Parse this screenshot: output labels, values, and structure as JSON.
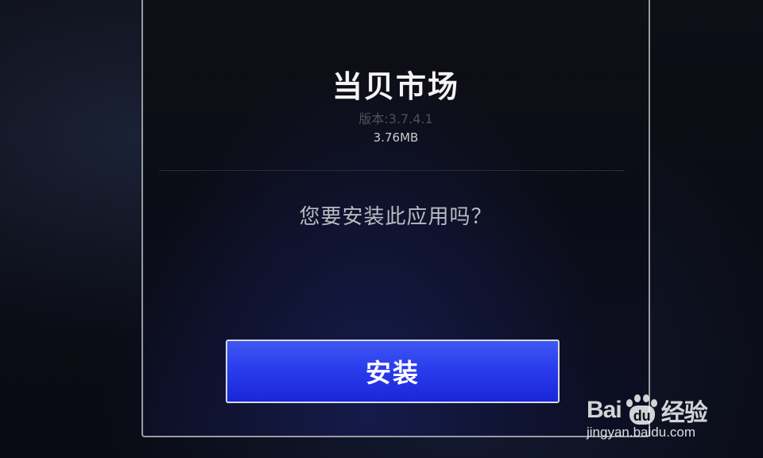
{
  "dialog": {
    "app_name": "当贝市场",
    "version": "版本:3.7.4.1",
    "size": "3.76MB",
    "question": "您要安装此应用吗？",
    "install_label": "安装"
  },
  "watermark": {
    "logo_prefix": "Bai",
    "logo_du": "du",
    "logo_suffix": "经验",
    "url": "jingyan.baidu.com"
  }
}
